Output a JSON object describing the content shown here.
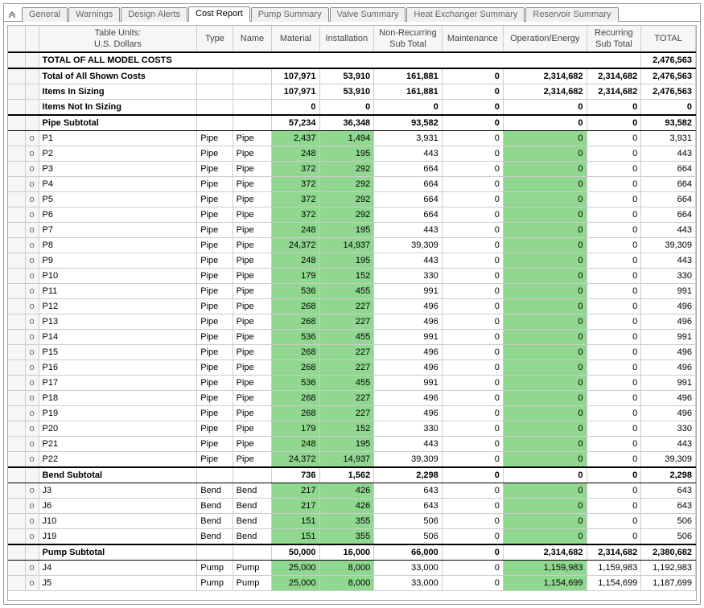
{
  "tabs": [
    "General",
    "Warnings",
    "Design Alerts",
    "Cost Report",
    "Pump Summary",
    "Valve Summary",
    "Heat Exchanger Summary",
    "Reservoir Summary"
  ],
  "active_tab": "Cost Report",
  "columns": {
    "units": "Table Units:\nU.S. Dollars",
    "type": "Type",
    "name": "Name",
    "material": "Material",
    "installation": "Installation",
    "nonrecurring": "Non-Recurring\nSub Total",
    "maintenance": "Maintenance",
    "operation": "Operation/Energy",
    "recurring": "Recurring\nSub Total",
    "total": "TOTAL"
  },
  "chart_data": {
    "type": "table",
    "title": "Cost Report",
    "columns": [
      "Name",
      "Type",
      "Name2",
      "Material",
      "Installation",
      "Non-Recurring Sub Total",
      "Maintenance",
      "Operation/Energy",
      "Recurring Sub Total",
      "TOTAL"
    ],
    "rows": [
      {
        "kind": "title",
        "label": "TOTAL OF ALL MODEL COSTS",
        "total": "2,476,563"
      },
      {
        "kind": "bold",
        "label": "Total of All Shown Costs",
        "material": "107,971",
        "installation": "53,910",
        "nrst": "161,881",
        "maint": "0",
        "ope": "2,314,682",
        "rst": "2,314,682",
        "total": "2,476,563"
      },
      {
        "kind": "bold",
        "label": "Items In Sizing",
        "material": "107,971",
        "installation": "53,910",
        "nrst": "161,881",
        "maint": "0",
        "ope": "2,314,682",
        "rst": "2,314,682",
        "total": "2,476,563"
      },
      {
        "kind": "bold",
        "label": "Items Not In Sizing",
        "material": "0",
        "installation": "0",
        "nrst": "0",
        "maint": "0",
        "ope": "0",
        "rst": "0",
        "total": "0"
      },
      {
        "kind": "section",
        "label": "Pipe Subtotal",
        "material": "57,234",
        "installation": "36,348",
        "nrst": "93,582",
        "maint": "0",
        "ope": "0",
        "rst": "0",
        "total": "93,582"
      },
      {
        "kind": "data",
        "exp": "o",
        "label": "P1",
        "type": "Pipe",
        "iname": "Pipe",
        "material": "2,437",
        "installation": "1,494",
        "nrst": "3,931",
        "maint": "0",
        "ope": "0",
        "rst": "0",
        "total": "3,931",
        "hl": true
      },
      {
        "kind": "data",
        "exp": "o",
        "label": "P2",
        "type": "Pipe",
        "iname": "Pipe",
        "material": "248",
        "installation": "195",
        "nrst": "443",
        "maint": "0",
        "ope": "0",
        "rst": "0",
        "total": "443",
        "hl": true
      },
      {
        "kind": "data",
        "exp": "o",
        "label": "P3",
        "type": "Pipe",
        "iname": "Pipe",
        "material": "372",
        "installation": "292",
        "nrst": "664",
        "maint": "0",
        "ope": "0",
        "rst": "0",
        "total": "664",
        "hl": true
      },
      {
        "kind": "data",
        "exp": "o",
        "label": "P4",
        "type": "Pipe",
        "iname": "Pipe",
        "material": "372",
        "installation": "292",
        "nrst": "664",
        "maint": "0",
        "ope": "0",
        "rst": "0",
        "total": "664",
        "hl": true
      },
      {
        "kind": "data",
        "exp": "o",
        "label": "P5",
        "type": "Pipe",
        "iname": "Pipe",
        "material": "372",
        "installation": "292",
        "nrst": "664",
        "maint": "0",
        "ope": "0",
        "rst": "0",
        "total": "664",
        "hl": true
      },
      {
        "kind": "data",
        "exp": "o",
        "label": "P6",
        "type": "Pipe",
        "iname": "Pipe",
        "material": "372",
        "installation": "292",
        "nrst": "664",
        "maint": "0",
        "ope": "0",
        "rst": "0",
        "total": "664",
        "hl": true
      },
      {
        "kind": "data",
        "exp": "o",
        "label": "P7",
        "type": "Pipe",
        "iname": "Pipe",
        "material": "248",
        "installation": "195",
        "nrst": "443",
        "maint": "0",
        "ope": "0",
        "rst": "0",
        "total": "443",
        "hl": true
      },
      {
        "kind": "data",
        "exp": "o",
        "label": "P8",
        "type": "Pipe",
        "iname": "Pipe",
        "material": "24,372",
        "installation": "14,937",
        "nrst": "39,309",
        "maint": "0",
        "ope": "0",
        "rst": "0",
        "total": "39,309",
        "hl": true
      },
      {
        "kind": "data",
        "exp": "o",
        "label": "P9",
        "type": "Pipe",
        "iname": "Pipe",
        "material": "248",
        "installation": "195",
        "nrst": "443",
        "maint": "0",
        "ope": "0",
        "rst": "0",
        "total": "443",
        "hl": true
      },
      {
        "kind": "data",
        "exp": "o",
        "label": "P10",
        "type": "Pipe",
        "iname": "Pipe",
        "material": "179",
        "installation": "152",
        "nrst": "330",
        "maint": "0",
        "ope": "0",
        "rst": "0",
        "total": "330",
        "hl": true
      },
      {
        "kind": "data",
        "exp": "o",
        "label": "P11",
        "type": "Pipe",
        "iname": "Pipe",
        "material": "536",
        "installation": "455",
        "nrst": "991",
        "maint": "0",
        "ope": "0",
        "rst": "0",
        "total": "991",
        "hl": true
      },
      {
        "kind": "data",
        "exp": "o",
        "label": "P12",
        "type": "Pipe",
        "iname": "Pipe",
        "material": "268",
        "installation": "227",
        "nrst": "496",
        "maint": "0",
        "ope": "0",
        "rst": "0",
        "total": "496",
        "hl": true
      },
      {
        "kind": "data",
        "exp": "o",
        "label": "P13",
        "type": "Pipe",
        "iname": "Pipe",
        "material": "268",
        "installation": "227",
        "nrst": "496",
        "maint": "0",
        "ope": "0",
        "rst": "0",
        "total": "496",
        "hl": true
      },
      {
        "kind": "data",
        "exp": "o",
        "label": "P14",
        "type": "Pipe",
        "iname": "Pipe",
        "material": "536",
        "installation": "455",
        "nrst": "991",
        "maint": "0",
        "ope": "0",
        "rst": "0",
        "total": "991",
        "hl": true
      },
      {
        "kind": "data",
        "exp": "o",
        "label": "P15",
        "type": "Pipe",
        "iname": "Pipe",
        "material": "268",
        "installation": "227",
        "nrst": "496",
        "maint": "0",
        "ope": "0",
        "rst": "0",
        "total": "496",
        "hl": true
      },
      {
        "kind": "data",
        "exp": "o",
        "label": "P16",
        "type": "Pipe",
        "iname": "Pipe",
        "material": "268",
        "installation": "227",
        "nrst": "496",
        "maint": "0",
        "ope": "0",
        "rst": "0",
        "total": "496",
        "hl": true
      },
      {
        "kind": "data",
        "exp": "o",
        "label": "P17",
        "type": "Pipe",
        "iname": "Pipe",
        "material": "536",
        "installation": "455",
        "nrst": "991",
        "maint": "0",
        "ope": "0",
        "rst": "0",
        "total": "991",
        "hl": true
      },
      {
        "kind": "data",
        "exp": "o",
        "label": "P18",
        "type": "Pipe",
        "iname": "Pipe",
        "material": "268",
        "installation": "227",
        "nrst": "496",
        "maint": "0",
        "ope": "0",
        "rst": "0",
        "total": "496",
        "hl": true
      },
      {
        "kind": "data",
        "exp": "o",
        "label": "P19",
        "type": "Pipe",
        "iname": "Pipe",
        "material": "268",
        "installation": "227",
        "nrst": "496",
        "maint": "0",
        "ope": "0",
        "rst": "0",
        "total": "496",
        "hl": true
      },
      {
        "kind": "data",
        "exp": "o",
        "label": "P20",
        "type": "Pipe",
        "iname": "Pipe",
        "material": "179",
        "installation": "152",
        "nrst": "330",
        "maint": "0",
        "ope": "0",
        "rst": "0",
        "total": "330",
        "hl": true
      },
      {
        "kind": "data",
        "exp": "o",
        "label": "P21",
        "type": "Pipe",
        "iname": "Pipe",
        "material": "248",
        "installation": "195",
        "nrst": "443",
        "maint": "0",
        "ope": "0",
        "rst": "0",
        "total": "443",
        "hl": true
      },
      {
        "kind": "data",
        "exp": "o",
        "label": "P22",
        "type": "Pipe",
        "iname": "Pipe",
        "material": "24,372",
        "installation": "14,937",
        "nrst": "39,309",
        "maint": "0",
        "ope": "0",
        "rst": "0",
        "total": "39,309",
        "hl": true
      },
      {
        "kind": "section",
        "label": "Bend Subtotal",
        "material": "736",
        "installation": "1,562",
        "nrst": "2,298",
        "maint": "0",
        "ope": "0",
        "rst": "0",
        "total": "2,298"
      },
      {
        "kind": "data",
        "exp": "o",
        "label": "J3",
        "type": "Bend",
        "iname": "Bend",
        "material": "217",
        "installation": "426",
        "nrst": "643",
        "maint": "0",
        "ope": "0",
        "rst": "0",
        "total": "643",
        "hl": true
      },
      {
        "kind": "data",
        "exp": "o",
        "label": "J6",
        "type": "Bend",
        "iname": "Bend",
        "material": "217",
        "installation": "426",
        "nrst": "643",
        "maint": "0",
        "ope": "0",
        "rst": "0",
        "total": "643",
        "hl": true
      },
      {
        "kind": "data",
        "exp": "o",
        "label": "J10",
        "type": "Bend",
        "iname": "Bend",
        "material": "151",
        "installation": "355",
        "nrst": "506",
        "maint": "0",
        "ope": "0",
        "rst": "0",
        "total": "506",
        "hl": true
      },
      {
        "kind": "data",
        "exp": "o",
        "label": "J19",
        "type": "Bend",
        "iname": "Bend",
        "material": "151",
        "installation": "355",
        "nrst": "506",
        "maint": "0",
        "ope": "0",
        "rst": "0",
        "total": "506",
        "hl": true
      },
      {
        "kind": "section",
        "label": "Pump Subtotal",
        "material": "50,000",
        "installation": "16,000",
        "nrst": "66,000",
        "maint": "0",
        "ope": "2,314,682",
        "rst": "2,314,682",
        "total": "2,380,682"
      },
      {
        "kind": "data",
        "exp": "o",
        "label": "J4",
        "type": "Pump",
        "iname": "Pump",
        "material": "25,000",
        "installation": "8,000",
        "nrst": "33,000",
        "maint": "0",
        "ope": "1,159,983",
        "rst": "1,159,983",
        "total": "1,192,983",
        "hl": true
      },
      {
        "kind": "data",
        "exp": "o",
        "label": "J5",
        "type": "Pump",
        "iname": "Pump",
        "material": "25,000",
        "installation": "8,000",
        "nrst": "33,000",
        "maint": "0",
        "ope": "1,154,699",
        "rst": "1,154,699",
        "total": "1,187,699",
        "hl": true
      }
    ]
  }
}
